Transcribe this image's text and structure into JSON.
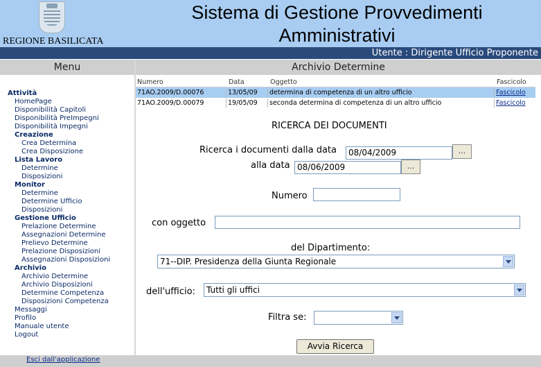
{
  "header": {
    "region": "REGIONE BASILICATA",
    "title_line1": "Sistema di Gestione Provvedimenti",
    "title_line2": "Amministrativi",
    "user": "Utente : Dirigente Ufficio Proponente",
    "logo_icon": "regione-basilicata-crest-icon"
  },
  "colors": {
    "header_bg": "#a9cdf2",
    "user_bar_bg": "#2a4a7c",
    "panel_head_bg": "#cfcfcf",
    "selected_row_bg": "#a8cdf2",
    "link": "#0a2a88"
  },
  "menu": {
    "title": "Menu",
    "items": [
      {
        "label": "Attività",
        "heading": true
      },
      {
        "label": "HomePage"
      },
      {
        "label": "Disponibilità Capitoli"
      },
      {
        "label": "Disponibilità PreImpegni"
      },
      {
        "label": "Disponibilità Impegni"
      },
      {
        "label": "Creazione",
        "heading": true
      },
      {
        "label": "Crea Determina"
      },
      {
        "label": "Crea Disposizione"
      },
      {
        "label": "Lista Lavoro",
        "heading": true
      },
      {
        "label": "Determine"
      },
      {
        "label": "Disposizioni"
      },
      {
        "label": "Monitor",
        "heading": true
      },
      {
        "label": "Determine"
      },
      {
        "label": "Determine Ufficio"
      },
      {
        "label": "Disposizioni"
      },
      {
        "label": "Gestione Ufficio",
        "heading": true
      },
      {
        "label": "Prelazione Determine"
      },
      {
        "label": "Assegnazioni Determine"
      },
      {
        "label": "Prelievo Determine"
      },
      {
        "label": "Prelazione Disposizioni"
      },
      {
        "label": "Assegnazioni Disposizioni"
      },
      {
        "label": "Archivio",
        "heading": true
      },
      {
        "label": "Archivio Determine"
      },
      {
        "label": "Archivio Disposizioni"
      },
      {
        "label": "Determine Competenza"
      },
      {
        "label": "Disposizioni Competenza"
      },
      {
        "label": "Messaggi"
      },
      {
        "label": "Profilo"
      },
      {
        "label": "Manuale utente"
      },
      {
        "label": "Logout"
      }
    ],
    "exit_link": "Esci dall'applicazione"
  },
  "main": {
    "title": "Archivio Determine",
    "table": {
      "columns": [
        "Numero",
        "Data",
        "Oggetto",
        "Fascicolo"
      ],
      "rows": [
        {
          "numero": "71AO.2009/D.00076",
          "data": "13/05/09",
          "oggetto": "determina di competenza di un altro ufficio",
          "fascicolo": "Fascicolo",
          "selected": true
        },
        {
          "numero": "71AO.2009/D.00079",
          "data": "19/05/09",
          "oggetto": "seconda determina di competenza di un altro ufficio",
          "fascicolo": "Fascicolo",
          "selected": false
        }
      ]
    },
    "search": {
      "title": "RICERCA DEI DOCUMENTI",
      "from_label": "Ricerca i documenti dalla data",
      "from_value": "08/04/2009",
      "to_label": "alla data",
      "to_value": "08/06/2009",
      "picker_label": "...",
      "numero_label": "Numero",
      "numero_value": "",
      "oggetto_label": "con oggetto",
      "oggetto_value": "",
      "dipartimento_label": "del Dipartimento:",
      "dipartimento_value": "71--DIP. Presidenza della Giunta Regionale",
      "ufficio_label": "dell'ufficio:",
      "ufficio_value": "Tutti gli uffici",
      "filtra_label": "Filtra se:",
      "filtra_value": "",
      "submit_label": "Avvia Ricerca"
    }
  }
}
